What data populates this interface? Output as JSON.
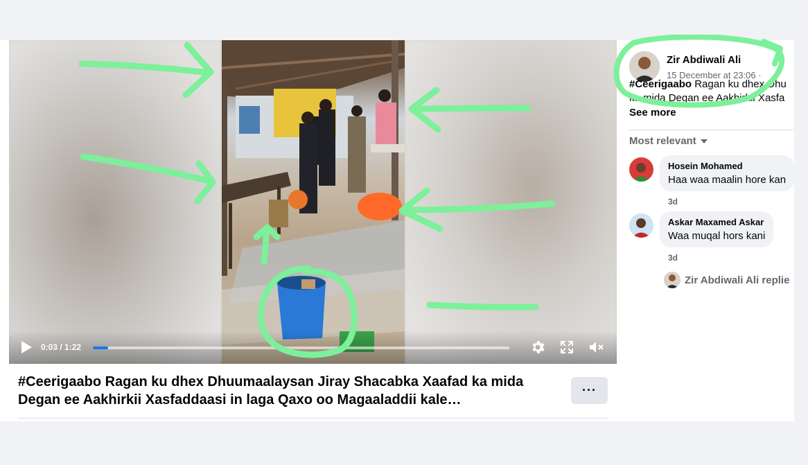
{
  "video": {
    "current_time": "0:03",
    "duration": "1:22",
    "time_separator": " / ",
    "progress_fraction": 0.037
  },
  "post": {
    "title": "#Ceerigaabo Ragan ku dhex Dhuumaalaysan Jiray Shacabka Xaafad ka mida Degan ee Aakhirkii Xasfaddaasi in laga Qaxo oo Magaaladdii kale…",
    "more_label": "···",
    "author": "Zir Abdiwali Ali",
    "date": "15 December at 23:06 ·",
    "hashtag": "#Ceerigaabo",
    "text_line1": " Ragan ku dhex Dhu",
    "text_line2": "ka mida Degan ee Aakhirkii Xasfa",
    "see_more": "See more"
  },
  "comments": {
    "sort_label": "Most relevant",
    "items": [
      {
        "name": "Hosein Mohamed",
        "text": "Haa waa maalin hore kan",
        "time": "3d"
      },
      {
        "name": "Askar Maxamed Askar",
        "text": "Waa muqal hors kani",
        "time": "3d"
      }
    ],
    "reply_preview": "Zir Abdiwali Ali replie"
  },
  "colors": {
    "annotation_green": "#7cf09a",
    "progress_blue": "#1877f2"
  },
  "icons": [
    "play-icon",
    "settings-gear-icon",
    "fullscreen-icon",
    "volume-muted-icon",
    "more-options-icon",
    "dropdown-caret-icon"
  ]
}
